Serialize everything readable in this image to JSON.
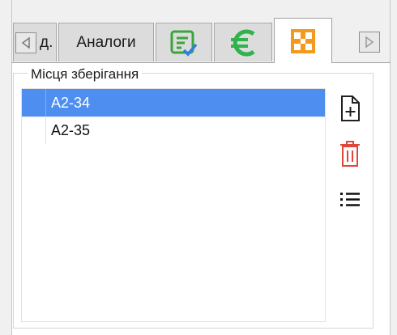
{
  "tabs": {
    "truncated_label": "д.",
    "analogs_label": "Аналоги",
    "check_icon": "checklist-icon",
    "euro_icon": "euro-icon",
    "grid_icon": "storage-grid-icon",
    "active_tab": "storage-grid-icon"
  },
  "group": {
    "title": "Місця зберігання"
  },
  "storage_list": {
    "rows": [
      {
        "value": "A2-34",
        "selected": true
      },
      {
        "value": "A2-35",
        "selected": false
      }
    ]
  },
  "actions": {
    "add_icon": "add-document-icon",
    "delete_icon": "trash-icon",
    "list_icon": "list-icon"
  },
  "colors": {
    "selection": "#4d8ef0",
    "check_green": "#3aa53a",
    "euro_green": "#2fb34a",
    "grid_orange": "#f39a1e",
    "delete_red": "#e0473a"
  }
}
